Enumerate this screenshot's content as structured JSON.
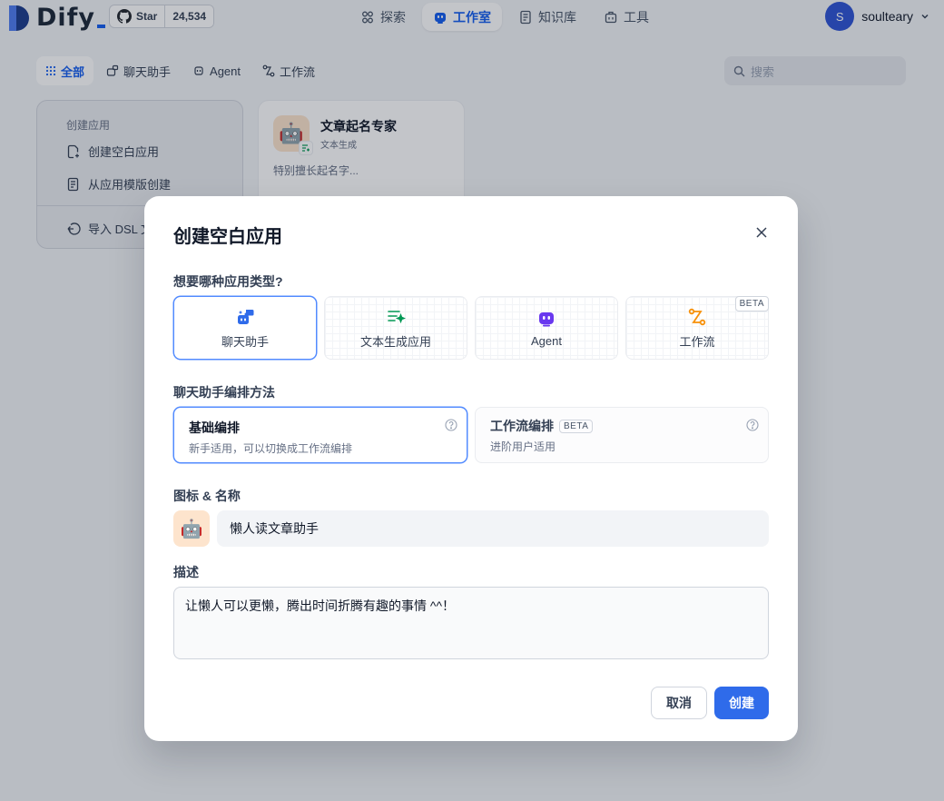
{
  "brand": {
    "logo_text": "Dify"
  },
  "github": {
    "star_label": "Star",
    "star_count": "24,534"
  },
  "nav": {
    "items": [
      {
        "label": "探索",
        "icon": "explore-icon"
      },
      {
        "label": "工作室",
        "icon": "robot-icon",
        "active": true
      },
      {
        "label": "知识库",
        "icon": "book-icon"
      },
      {
        "label": "工具",
        "icon": "toolbox-icon"
      }
    ]
  },
  "user": {
    "initial": "S",
    "name": "soulteary"
  },
  "filters": {
    "items": [
      {
        "label": "全部",
        "active": true
      },
      {
        "label": "聊天助手"
      },
      {
        "label": "Agent"
      },
      {
        "label": "工作流"
      }
    ],
    "search_placeholder": "搜索"
  },
  "create_card": {
    "title": "创建应用",
    "blank": "创建空白应用",
    "template": "从应用模版创建",
    "import": "导入 DSL 文件"
  },
  "app_card": {
    "name": "文章起名专家",
    "type": "文本生成",
    "description": "特别擅长起名字..."
  },
  "modal": {
    "title": "创建空白应用",
    "type_label": "想要哪种应用类型?",
    "types": [
      {
        "label": "聊天助手",
        "selected": true
      },
      {
        "label": "文本生成应用"
      },
      {
        "label": "Agent"
      },
      {
        "label": "工作流",
        "beta": "BETA"
      }
    ],
    "mode_label": "聊天助手编排方法",
    "modes": [
      {
        "title": "基础编排",
        "desc": "新手适用，可以切换成工作流编排",
        "selected": true
      },
      {
        "title": "工作流编排",
        "beta": "BETA",
        "desc": "进阶用户适用"
      }
    ],
    "name_label": "图标 & 名称",
    "name_value": "懒人读文章助手",
    "desc_label": "描述",
    "desc_value": "让懒人可以更懒，腾出时间折腾有趣的事情 ^^！",
    "cancel": "取消",
    "create": "创建"
  },
  "colors": {
    "primary": "#155eef",
    "create_button": "#2f6bea",
    "avatar": "#2f55d4",
    "icon_bg": "#fde4cd"
  }
}
